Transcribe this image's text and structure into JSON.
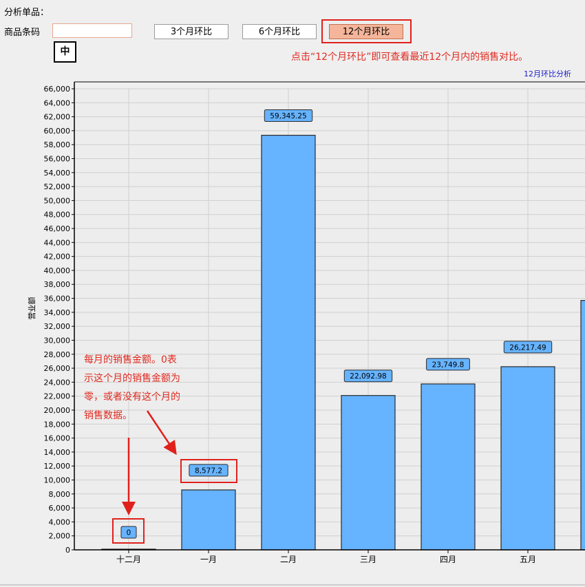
{
  "form": {
    "section_label": "分析单品：",
    "barcode_label": "商品条码",
    "barcode_value": "",
    "ime_indicator": "中",
    "buttons": [
      "3个月环比",
      "6个月环比",
      "12个月环比"
    ],
    "active_button": "12个月环比"
  },
  "annotations": {
    "hint_top": "点击“12个月环比”即可查看最近12个月内的销售对比。",
    "note_lines": [
      "每月的销售金额。0表",
      "示这个月的销售金额为",
      "零，或者没有这个月的",
      "销售数据。"
    ]
  },
  "colors": {
    "bar": "#66b3ff",
    "annotation": "#e0201b",
    "active_button": "#f5b59a"
  },
  "chart_data": {
    "type": "bar",
    "title": "12月环比分析",
    "ylabel": "营业额",
    "xlabel": "",
    "categories": [
      "十二月",
      "一月",
      "二月",
      "三月",
      "四月",
      "五月"
    ],
    "values": [
      0,
      8577.2,
      59345.25,
      22092.98,
      23749.8,
      26217.49
    ],
    "value_labels": [
      "0",
      "8,577.2",
      "59,345.25",
      "22,092.98",
      "23,749.8",
      "26,217.49"
    ],
    "partial_next_bar_value": 35700,
    "ylim": [
      0,
      66000
    ],
    "ytick_step": 2000,
    "grid": true
  }
}
